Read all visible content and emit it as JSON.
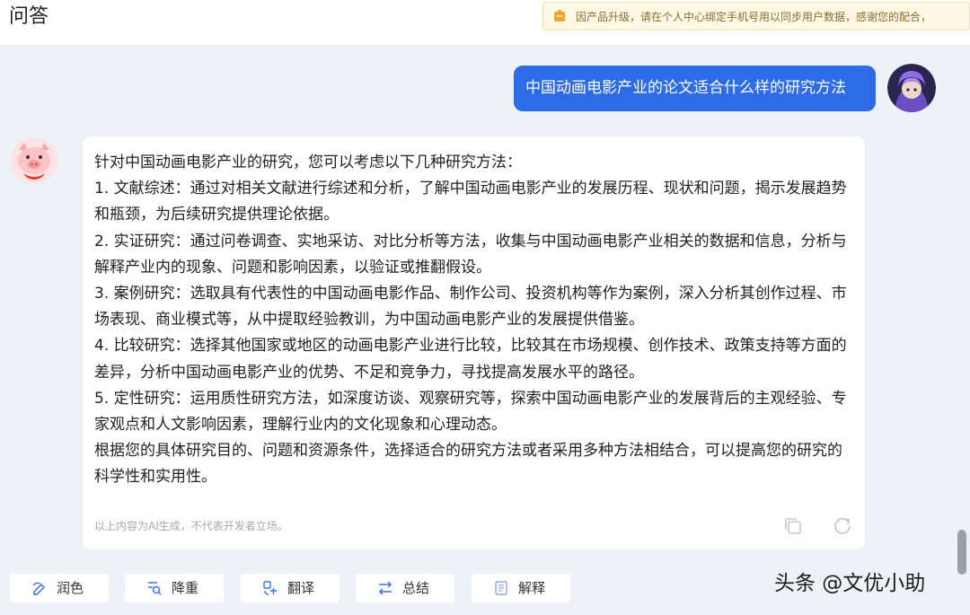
{
  "header": {
    "title": "问答",
    "notice": "因产品升级，请在个人中心绑定手机号用以同步用户数据，感谢您的配合，"
  },
  "chat": {
    "user_message": "中国动画电影产业的论文适合什么样的研究方法",
    "answer": {
      "lines": [
        "针对中国动画电影产业的研究，您可以考虑以下几种研究方法：",
        "1. 文献综述：通过对相关文献进行综述和分析，了解中国动画电影产业的发展历程、现状和问题，揭示发展趋势和瓶颈，为后续研究提供理论依据。",
        "2. 实证研究：通过问卷调查、实地采访、对比分析等方法，收集与中国动画电影产业相关的数据和信息，分析与解释产业内的现象、问题和影响因素，以验证或推翻假设。",
        "3. 案例研究：选取具有代表性的中国动画电影作品、制作公司、投资机构等作为案例，深入分析其创作过程、市场表现、商业模式等，从中提取经验教训，为中国动画电影产业的发展提供借鉴。",
        "4. 比较研究：选择其他国家或地区的动画电影产业进行比较，比较其在市场规模、创作技术、政策支持等方面的差异，分析中国动画电影产业的优势、不足和竞争力，寻找提高发展水平的路径。",
        "5. 定性研究：运用质性研究方法，如深度访谈、观察研究等，探索中国动画电影产业的发展背后的主观经验、专家观点和人文影响因素，理解行业内的文化现象和心理动态。",
        "根据您的具体研究目的、问题和资源条件，选择适合的研究方法或者采用多种方法相结合，可以提高您的研究的科学性和实用性。"
      ],
      "disclaimer": "以上内容为AI生成，不代表开发者立场。"
    }
  },
  "toolbar": {
    "buttons": [
      {
        "label": "润色",
        "icon": "polish-icon"
      },
      {
        "label": "降重",
        "icon": "dedupe-icon"
      },
      {
        "label": "翻译",
        "icon": "translate-icon"
      },
      {
        "label": "总结",
        "icon": "summarize-icon"
      },
      {
        "label": "解释",
        "icon": "explain-icon"
      }
    ]
  },
  "watermark": "头条 @文优小助",
  "colors": {
    "accent": "#2e6be6",
    "background": "#eef1f6",
    "notice_bg": "#fff8e6",
    "notice_text": "#8a6d2e"
  }
}
